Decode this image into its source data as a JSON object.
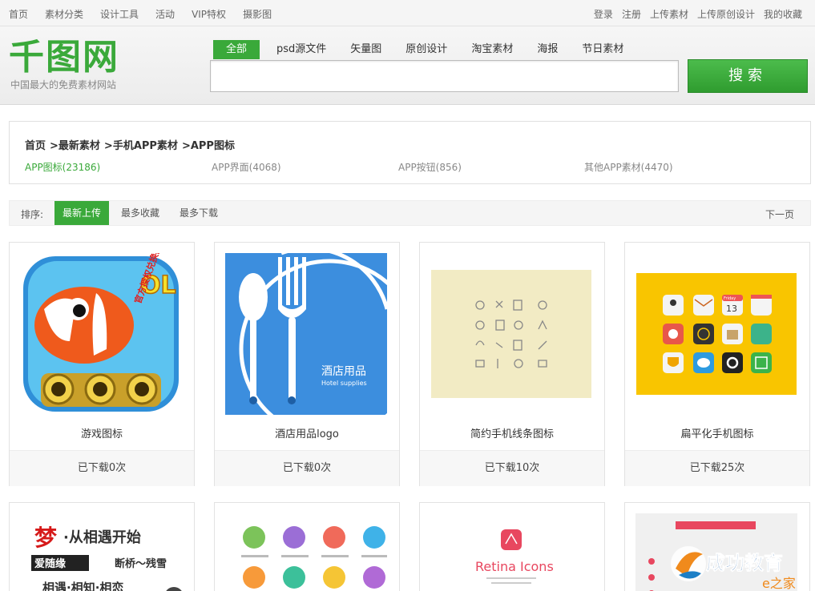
{
  "topnav": [
    "首页",
    "素材分类",
    "设计工具",
    "活动",
    "VIP特权",
    "摄影图"
  ],
  "toplinks": [
    "登录",
    "注册",
    "上传素材",
    "上传原创设计",
    "我的收藏"
  ],
  "logo": {
    "text": "千图网",
    "subtitle": "中国最大的免费素材网站"
  },
  "search": {
    "tabs": [
      "全部",
      "psd源文件",
      "矢量图",
      "原创设计",
      "淘宝素材",
      "海报",
      "节日素材"
    ],
    "active_tab": 0,
    "placeholder": "",
    "button": "搜索"
  },
  "breadcrumb": [
    "首页",
    ">最新素材",
    ">手机APP素材",
    ">APP图标"
  ],
  "subcats": [
    "APP图标(23186)",
    "APP界面(4068)",
    "APP按钮(856)",
    "其他APP素材(4470)"
  ],
  "sort": {
    "label": "排序:",
    "options": [
      "最新上传",
      "最多收藏",
      "最多下载"
    ],
    "next": "下一页"
  },
  "cards": [
    {
      "title": "游戏图标",
      "downloads": "已下载0次",
      "thumb_text": [
        "OL",
        "官方授权兑换码"
      ]
    },
    {
      "title": "酒店用品logo",
      "downloads": "已下载0次",
      "thumb_text": [
        "酒店用品",
        "Hotel supplies"
      ]
    },
    {
      "title": "简约手机线条图标",
      "downloads": "已下载10次",
      "thumb_text": []
    },
    {
      "title": "扁平化手机图标",
      "downloads": "已下载25次",
      "thumb_text": [
        "Friday",
        "13"
      ]
    }
  ],
  "cards_row2": [
    {
      "thumb_text": [
        "梦",
        "·从相遇开始",
        "爱随缘",
        "断桥～残雪",
        "相遇·相知·相恋"
      ]
    },
    {
      "thumb_text": []
    },
    {
      "thumb_text": [
        "Retina Icons"
      ]
    },
    {
      "thumb_text": []
    }
  ],
  "watermark": {
    "text": "成功教育",
    "sub": "e之家"
  },
  "colors": {
    "brand_green": "#3aa93a",
    "blue_thumb": "#3c8ede",
    "yellow_thumb": "#f9c500",
    "beige_thumb": "#f2ebc4"
  }
}
